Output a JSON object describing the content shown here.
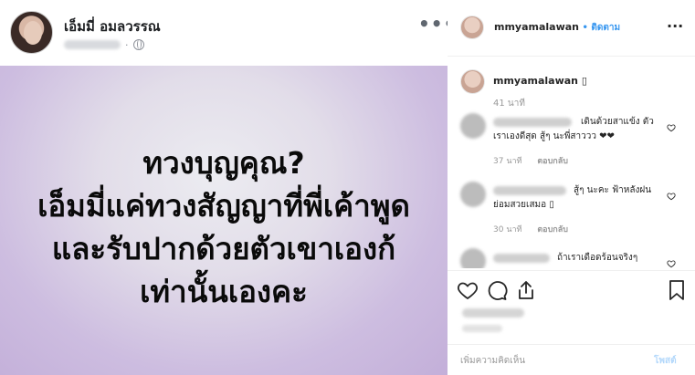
{
  "facebook": {
    "author_name": "เอ็มมี่ อมลวรรณ",
    "dot": "·",
    "image_text_lines": [
      "ทวงบุญคุณ?",
      "เอ็มมี่แค่ทวงสัญญาที่พี่เค้าพูด",
      "และรับปากด้วยตัวเขาเองก้",
      "เท่านั้นเองคะ"
    ]
  },
  "instagram": {
    "header": {
      "username": "mmyamalawan",
      "separator": " • ",
      "follow_label": "ติดตาม"
    },
    "caption": {
      "username": "mmyamalawan",
      "emoji": "▯",
      "time": "41 นาที"
    },
    "comments": [
      {
        "text": "เดินด้วยสาแข้ง ตัวเราเองดีสุด สู้ๆ นะพี่สาววว ❤❤",
        "time": "37 นาที",
        "reply_label": "ตอบกลับ"
      },
      {
        "text": "สู้ๆ นะคะ ฟ้าหลังฝนย่อมสวยเสมอ ▯",
        "time": "30 นาที",
        "reply_label": "ตอบกลับ"
      },
      {
        "text": "ถ้าเราเดือดร้อนจริงๆ",
        "time": "",
        "reply_label": ""
      }
    ],
    "add_comment_placeholder": "เพิ่มความคิดเห็น",
    "post_label": "โพสต์"
  },
  "colors": {
    "ig_link": "#3897f0",
    "ig_post_disabled": "#b3d8fb",
    "image_bg_light": "#ececf1",
    "image_bg_purple": "#c3afd9"
  }
}
